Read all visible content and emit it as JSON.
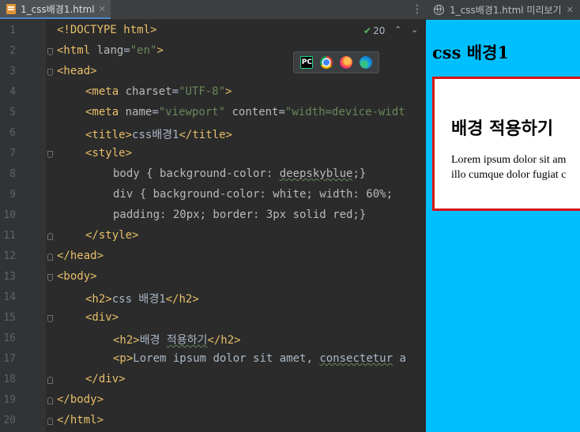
{
  "editor": {
    "tab_title": "1_css배경1.html",
    "inspection_count": "20",
    "line_numbers": [
      "1",
      "2",
      "3",
      "4",
      "5",
      "6",
      "7",
      "8",
      "9",
      "10",
      "11",
      "12",
      "13",
      "14",
      "15",
      "16",
      "17",
      "18",
      "19",
      "20"
    ],
    "lines": {
      "l1": {
        "a": "<!DOCTYPE html>"
      },
      "l2": {
        "a": "<html",
        "b": " lang",
        "c": "=",
        "d": "\"en\"",
        "e": ">"
      },
      "l3": {
        "a": "<head>"
      },
      "l4": {
        "a": "<meta",
        "b": " charset",
        "c": "=",
        "d": "\"UTF-8\"",
        "e": ">"
      },
      "l5": {
        "a": "<meta",
        "b": " name",
        "c": "=",
        "d": "\"viewport\"",
        "f": " content",
        "g": "=",
        "h": "\"width=device-widt"
      },
      "l6": {
        "a": "<title>",
        "b": "css배경1",
        "c": "</title>"
      },
      "l7": {
        "a": "<style>"
      },
      "l8": {
        "a": "body { background-color: ",
        "b": "deepskyblue",
        "c": ";}"
      },
      "l9": {
        "a": "div { background-color: white; width: 60%;"
      },
      "l10": {
        "a": "padding: 20px; border: 3px solid red;}"
      },
      "l11": {
        "a": "</style>"
      },
      "l12": {
        "a": "</head>"
      },
      "l13": {
        "a": "<body>"
      },
      "l14": {
        "a": "<h2>",
        "b": "css 배경1",
        "c": "</h2>"
      },
      "l15": {
        "a": "<div>"
      },
      "l16": {
        "a": "<h2>",
        "b": "배경 ",
        "c": "적용하기",
        "d": "</h2>"
      },
      "l17": {
        "a": "<p>",
        "b": "Lorem ipsum dolor sit amet, ",
        "c": "consectetur",
        "d": " a"
      },
      "l18": {
        "a": "</div>"
      },
      "l19": {
        "a": "</body>"
      },
      "l20": {
        "a": "</html>"
      }
    }
  },
  "browsers": [
    "pycharm-icon",
    "chrome-icon",
    "firefox-icon",
    "edge-icon"
  ],
  "preview": {
    "tab_title": "1_css배경1.html 미리보기",
    "heading": "css 배경1",
    "box_heading": "배경 적용하기",
    "paragraph_line1": "Lorem ipsum dolor sit am",
    "paragraph_line2": "illo cumque dolor fugiat c",
    "background_color": "#00bfff",
    "box_border_color": "#dd1212"
  }
}
